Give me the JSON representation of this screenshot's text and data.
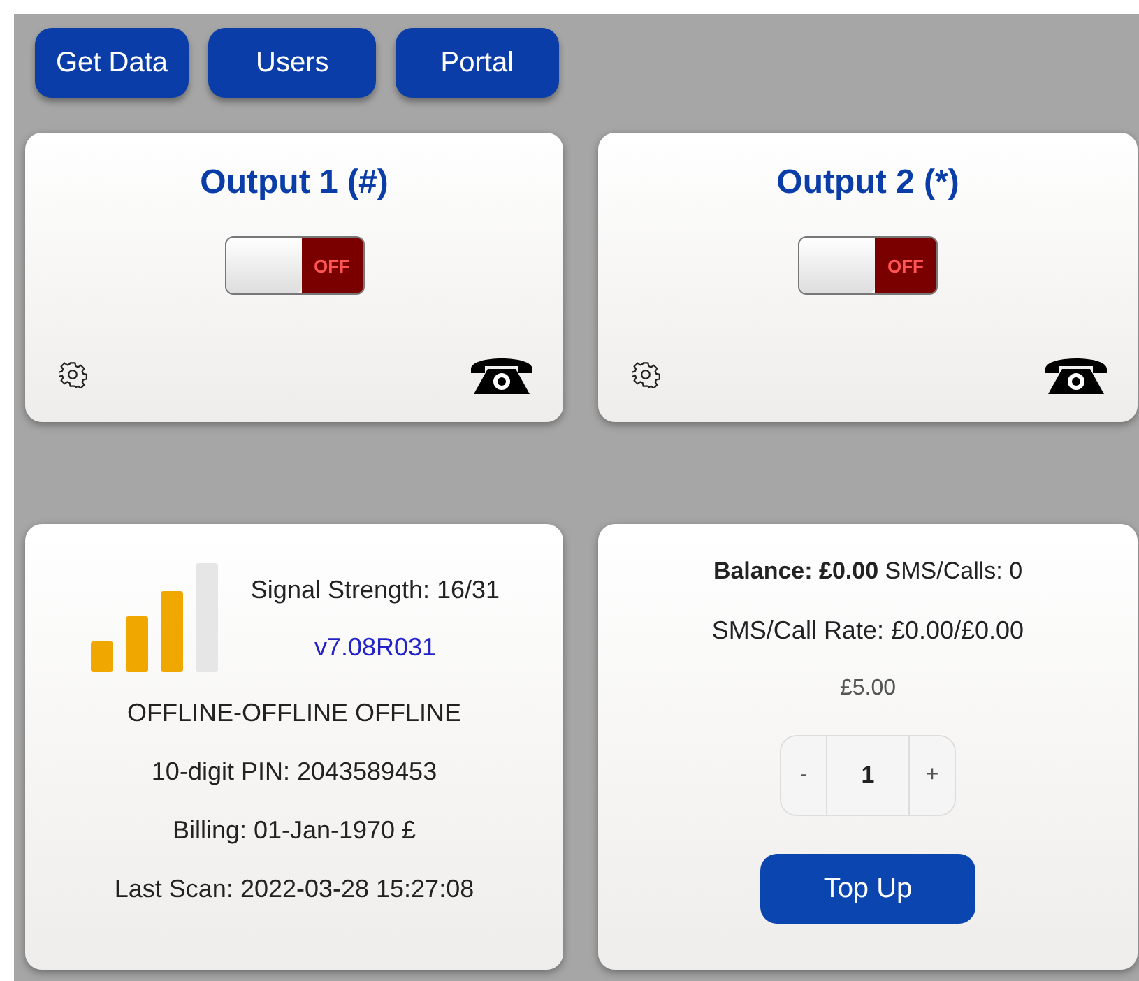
{
  "nav_buttons": [
    "Get Data",
    "Users",
    "Portal"
  ],
  "outputs": [
    {
      "title": "Output 1 (#)",
      "on": false,
      "switch_label": "OFF"
    },
    {
      "title": "Output 2 (*)",
      "on": false,
      "switch_label": "OFF"
    }
  ],
  "status": {
    "signal": "Signal Strength: 16/31",
    "version": "v7.08R031",
    "lines": [
      "OFFLINE-OFFLINE OFFLINE",
      "10-digit PIN: 2043589453",
      "Billing: 01-Jan-1970 £",
      "Last Scan: 2022-03-28 15:27:08"
    ]
  },
  "account": {
    "balance": "**Balance: £0.00** SMS/Calls: 0",
    "rate": "SMS/Call Rate: £0.00/£0.00",
    "price": "£5.00",
    "stepper": {
      "minus": "-",
      "value": "1",
      "plus": "+"
    },
    "button": "Top Up"
  }
}
